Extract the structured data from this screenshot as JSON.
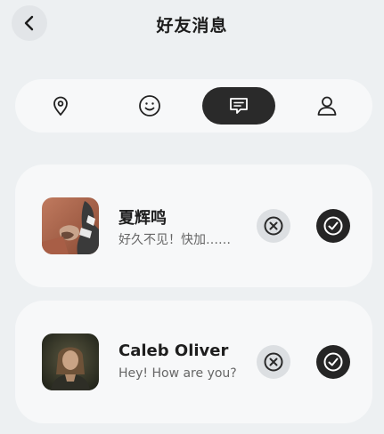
{
  "header": {
    "title": "好友消息",
    "back_icon": "chevron-left-icon"
  },
  "tabs": [
    {
      "icon": "location-pin-icon",
      "active": false
    },
    {
      "icon": "smiley-icon",
      "active": false
    },
    {
      "icon": "chat-bubble-icon",
      "active": true
    },
    {
      "icon": "person-icon",
      "active": false
    }
  ],
  "requests": [
    {
      "name": "夏辉鸣",
      "message": "好久不见！快加……",
      "avatar": "avatar-photo"
    },
    {
      "name": "Caleb Oliver",
      "message": "Hey! How are you?",
      "avatar": "avatar-photo"
    }
  ],
  "colors": {
    "background": "#edf0f2",
    "card": "#f7f8f9",
    "accent": "#2a2a2a"
  }
}
